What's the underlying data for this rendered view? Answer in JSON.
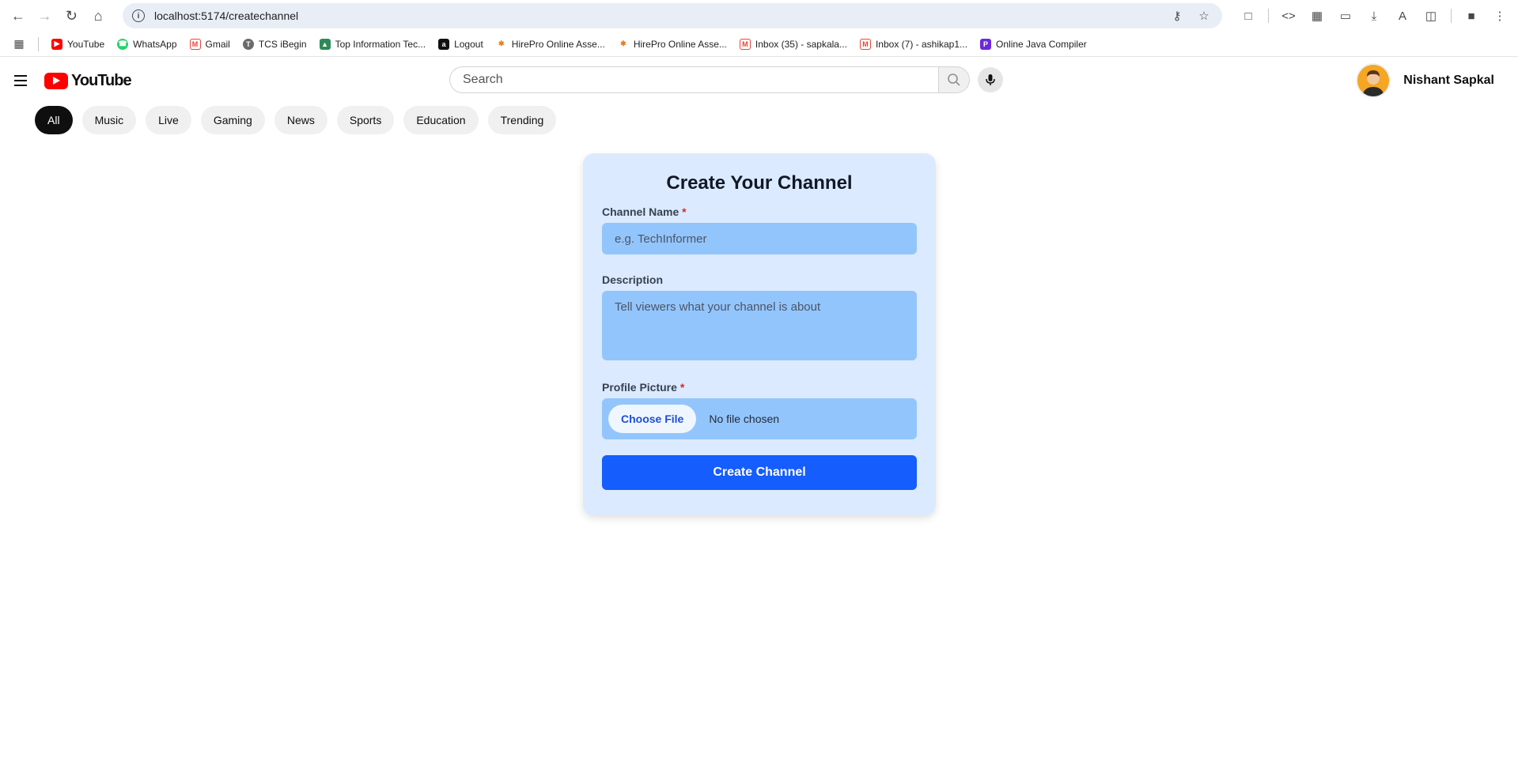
{
  "browser": {
    "url": "localhost:5174/createchannel",
    "bookmarks": [
      {
        "label": "YouTube",
        "icon": "youtube-icon",
        "color": "#ff0000"
      },
      {
        "label": "WhatsApp",
        "icon": "whatsapp-icon",
        "color": "#25d366"
      },
      {
        "label": "Gmail",
        "icon": "gmail-icon",
        "color": "#ea4335"
      },
      {
        "label": "TCS iBegin",
        "icon": "tcs-icon",
        "color": "#6b6b6b"
      },
      {
        "label": "Top Information Tec...",
        "icon": "site-icon",
        "color": "#2e8b57"
      },
      {
        "label": "Logout",
        "icon": "logout-icon",
        "color": "#111111"
      },
      {
        "label": "HirePro Online Asse...",
        "icon": "hirepro-icon",
        "color": "#e67e22"
      },
      {
        "label": "HirePro Online Asse...",
        "icon": "hirepro-icon",
        "color": "#e67e22"
      },
      {
        "label": "Inbox (35) - sapkala...",
        "icon": "gmail-icon",
        "color": "#ea4335"
      },
      {
        "label": "Inbox (7) - ashikap1...",
        "icon": "gmail-icon",
        "color": "#ea4335"
      },
      {
        "label": "Online Java Compiler",
        "icon": "compiler-icon",
        "color": "#6d28d9"
      }
    ]
  },
  "header": {
    "logo_text": "YouTube",
    "search_placeholder": "Search",
    "user_name": "Nishant Sapkal"
  },
  "chips": [
    {
      "label": "All",
      "active": true
    },
    {
      "label": "Music",
      "active": false
    },
    {
      "label": "Live",
      "active": false
    },
    {
      "label": "Gaming",
      "active": false
    },
    {
      "label": "News",
      "active": false
    },
    {
      "label": "Sports",
      "active": false
    },
    {
      "label": "Education",
      "active": false
    },
    {
      "label": "Trending",
      "active": false
    }
  ],
  "form": {
    "title": "Create Your Channel",
    "channel_name_label": "Channel Name",
    "channel_name_placeholder": "e.g. TechInformer",
    "description_label": "Description",
    "description_placeholder": "Tell viewers what your channel is about",
    "profile_picture_label": "Profile Picture",
    "required_mark": "*",
    "choose_file_label": "Choose File",
    "file_status": "No file chosen",
    "submit_label": "Create Channel"
  },
  "colors": {
    "brand_red": "#ff0000",
    "card_bg": "#dbeafe",
    "input_bg": "#93c5fd",
    "primary_button": "#155dfc"
  }
}
